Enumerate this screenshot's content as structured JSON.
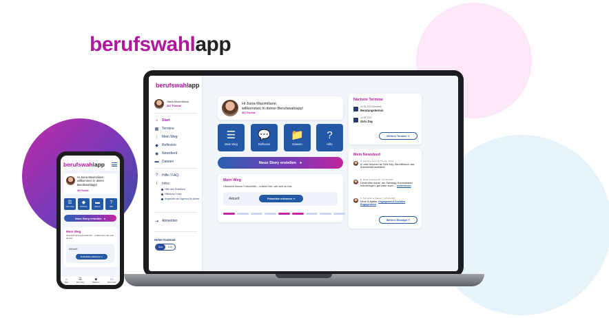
{
  "brand": {
    "part1": "berufswahl",
    "part2": "app"
  },
  "sidebar": {
    "user_name": "Jiana-Maximiliane",
    "user_points": "367 Punkte",
    "nav": [
      "Start",
      "Termine",
      "Mein Weg",
      "Reflexion",
      "Newsfeed",
      "Dateien",
      "Hilfe / FAQ",
      "Infos"
    ],
    "info_sub": [
      "Hilfe des Erstellers",
      "Hilfreiche Links",
      "Angebote der Agentur für Arbeit"
    ],
    "logout": "Abmelden",
    "kontrast_label": "Hoher Kontrast",
    "toggle_on": "Aus",
    "toggle_off": "Ein"
  },
  "welcome": {
    "greeting": "Hi Jiana-Maximiliane,",
    "subline": "willkommen in deiner Berufswahlapp!",
    "points": "367 Punkte"
  },
  "tiles": [
    "Mein Weg",
    "Reflexion",
    "Dateien",
    "Hilfe"
  ],
  "story_button": "Neue Story erstellen",
  "mein_weg": {
    "title": "Mein Weg",
    "desc": "Übersicht deines Fortschritts – erfahre hier, wie weit du bist.",
    "aktuell": "Aktuell:",
    "button": "Potentiale erkennen"
  },
  "termine": {
    "title": "Nächste Termine",
    "items": [
      {
        "meta": "24.06.2020 Bloschek",
        "name": "Beratungstermin"
      },
      {
        "meta": "12.08.2020",
        "name": "Girls Day"
      }
    ],
    "button": "Weitere Termine"
  },
  "newsfeed": {
    "title": "Mein Newsfeed",
    "items": [
      {
        "meta": "S. Schulz ▸ Stufe 11 | Heute, 14:03",
        "text": "In zwei Wochen ist Girls Day. Bis Mittwoch das Arbeitsblatt ausfüllen!",
        "link": ""
      },
      {
        "meta": "B. Müller ▸ Klasse 8b | 22.06.2020",
        "text": "Denkt bitte daran, am Samstag Gummistiefel mitzubringen, gut wäre auch ...",
        "link": "weiterlesen"
      },
      {
        "meta": "S. Schneider ▸ Klasse 7 | 15.06.2020",
        "text": "Neue Aufgabe:",
        "link": "Engagement Soziales Engagement"
      }
    ],
    "button": "Weitere Einträge"
  },
  "phone": {
    "greeting": "Hi Jiana-Maximiliane, willkommen in deiner Berufswahlapp!",
    "points": "367 Punkte",
    "tiles": [
      "Mein Weg",
      "Reflexion",
      "Dateien",
      "Hilfe"
    ],
    "story_button": "Neue Story erstellen",
    "weg_title": "Mein Weg",
    "weg_desc": "Übersicht deines Fortschritts – erfahre hier, wie weit du bist.",
    "aktuell": "Aktuell:",
    "button": "Potentiale erkennen",
    "bottom_nav": [
      "Start",
      "Mein Weg",
      "Reflexion",
      "Mein Fach"
    ]
  },
  "progress": {
    "done_segments": [
      0,
      4,
      5
    ]
  },
  "colors": {
    "brand_magenta": "#b0199e",
    "brand_blue": "#2358a6",
    "navy": "#2a3a6e"
  }
}
